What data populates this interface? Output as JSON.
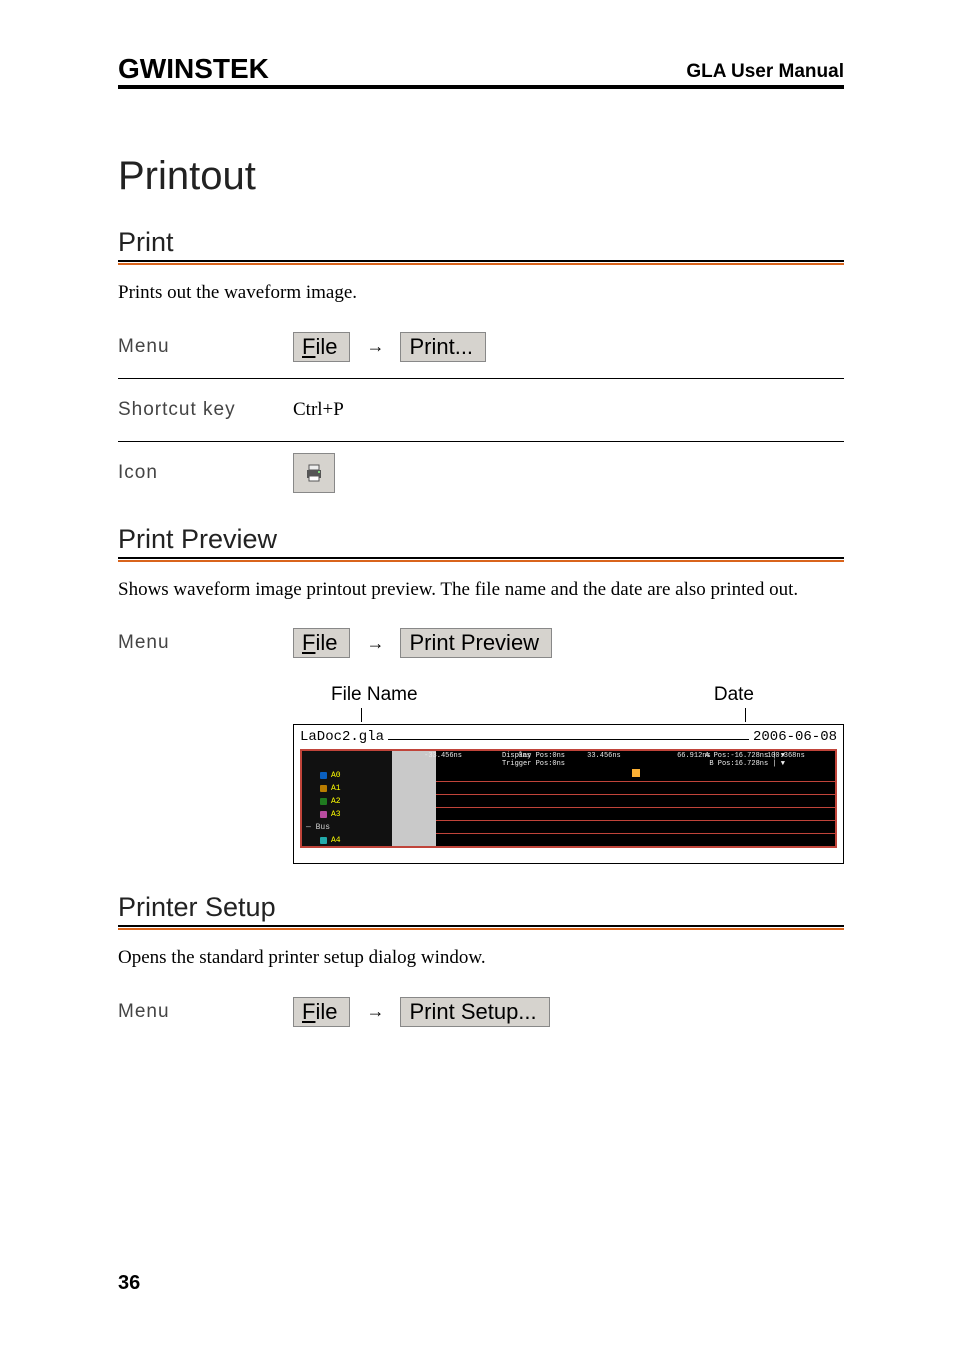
{
  "header": {
    "logo": "GWINSTEK",
    "manual_title": "GLA User Manual"
  },
  "page_title": "Printout",
  "page_number": "36",
  "sections": {
    "print": {
      "heading": "Print",
      "description": "Prints out the waveform image.",
      "menu_label": "Menu",
      "menu_path_1": "File",
      "menu_path_2": "Print...",
      "shortcut_label": "Shortcut key",
      "shortcut_value": "Ctrl+P",
      "icon_label": "Icon"
    },
    "preview": {
      "heading": "Print Preview",
      "description": "Shows waveform image printout preview. The file name and the date are also printed out.",
      "menu_label": "Menu",
      "menu_path_1": "File",
      "menu_path_2": "Print Preview",
      "filename_label": "File Name",
      "date_label": "Date",
      "filename_value": "LaDoc2.gla",
      "date_value": "2006-06-08"
    },
    "setup": {
      "heading": "Printer Setup",
      "description": "Opens the standard printer setup dialog window.",
      "menu_label": "Menu",
      "menu_path_1": "File",
      "menu_path_2": "Print Setup..."
    }
  },
  "arrow_glyph": "→"
}
